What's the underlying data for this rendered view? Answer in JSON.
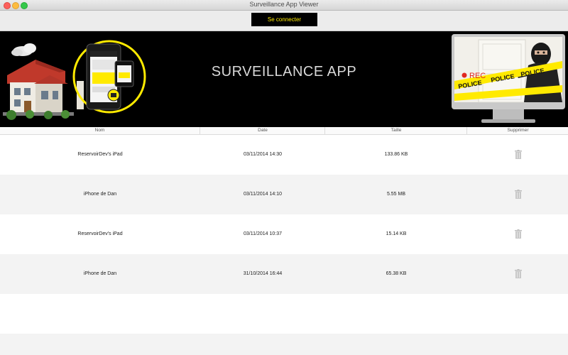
{
  "window": {
    "title": "Surveillance App Viewer"
  },
  "toolbar": {
    "connect_label": "Se connecter"
  },
  "banner": {
    "title": "SURVEILLANCE APP",
    "rec_label": "REC",
    "police_tape_label": "POLICE"
  },
  "table": {
    "headers": [
      "Nom",
      "Date",
      "Taille",
      "Supprimer"
    ],
    "rows": [
      {
        "name": "ReservoirDev's iPad",
        "date": "03/11/2014 14:30",
        "size": "133.86 KB"
      },
      {
        "name": "iPhone de Dan",
        "date": "03/11/2014 14:10",
        "size": "5.55 MB"
      },
      {
        "name": "ReservoirDev's iPad",
        "date": "03/11/2014 10:37",
        "size": "15.14 KB"
      },
      {
        "name": "iPhone de Dan",
        "date": "31/10/2014 16:44",
        "size": "65.38 KB"
      }
    ]
  },
  "colors": {
    "accent": "#ffea00",
    "banner_bg": "#000000",
    "rec_red": "#e0271f"
  }
}
